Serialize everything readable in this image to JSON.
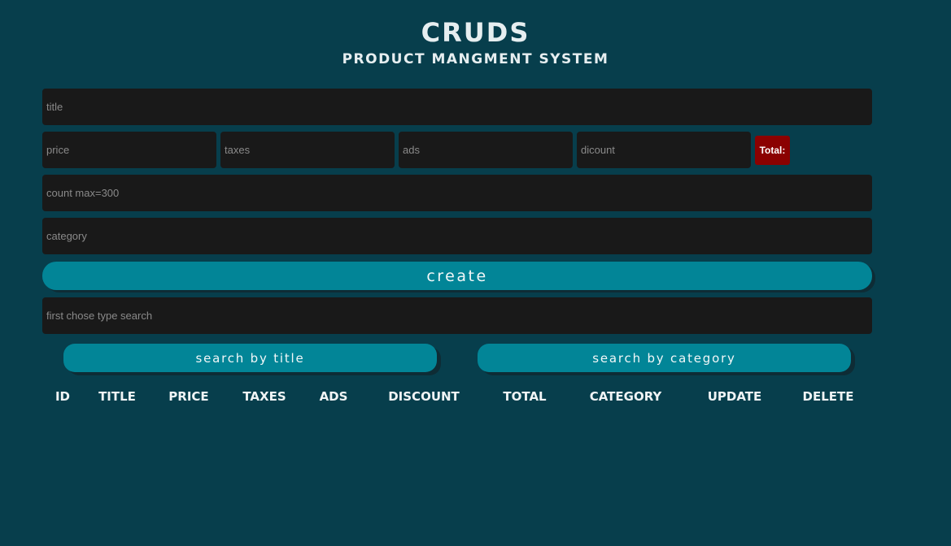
{
  "header": {
    "title": "CRUDS",
    "subtitle": "PRODUCT MANGMENT SYSTEM"
  },
  "form": {
    "title_placeholder": "title",
    "price_placeholder": "price",
    "taxes_placeholder": "taxes",
    "ads_placeholder": "ads",
    "discount_placeholder": "dicount",
    "total_label": "Total:",
    "count_placeholder": "count max=300",
    "category_placeholder": "category",
    "create_label": "create",
    "search_placeholder": "first chose type search"
  },
  "search": {
    "by_title_label": "search by title",
    "by_category_label": "search by category"
  },
  "table": {
    "columns": [
      "ID",
      "TITLE",
      "PRICE",
      "TAXES",
      "ADS",
      "DISCOUNT",
      "TOTAL",
      "CATEGORY",
      "UPDATE",
      "DELETE"
    ]
  },
  "colors": {
    "background": "#073e4c",
    "input_background": "#191919",
    "accent_button": "#028597",
    "total_badge": "#8b0101"
  }
}
